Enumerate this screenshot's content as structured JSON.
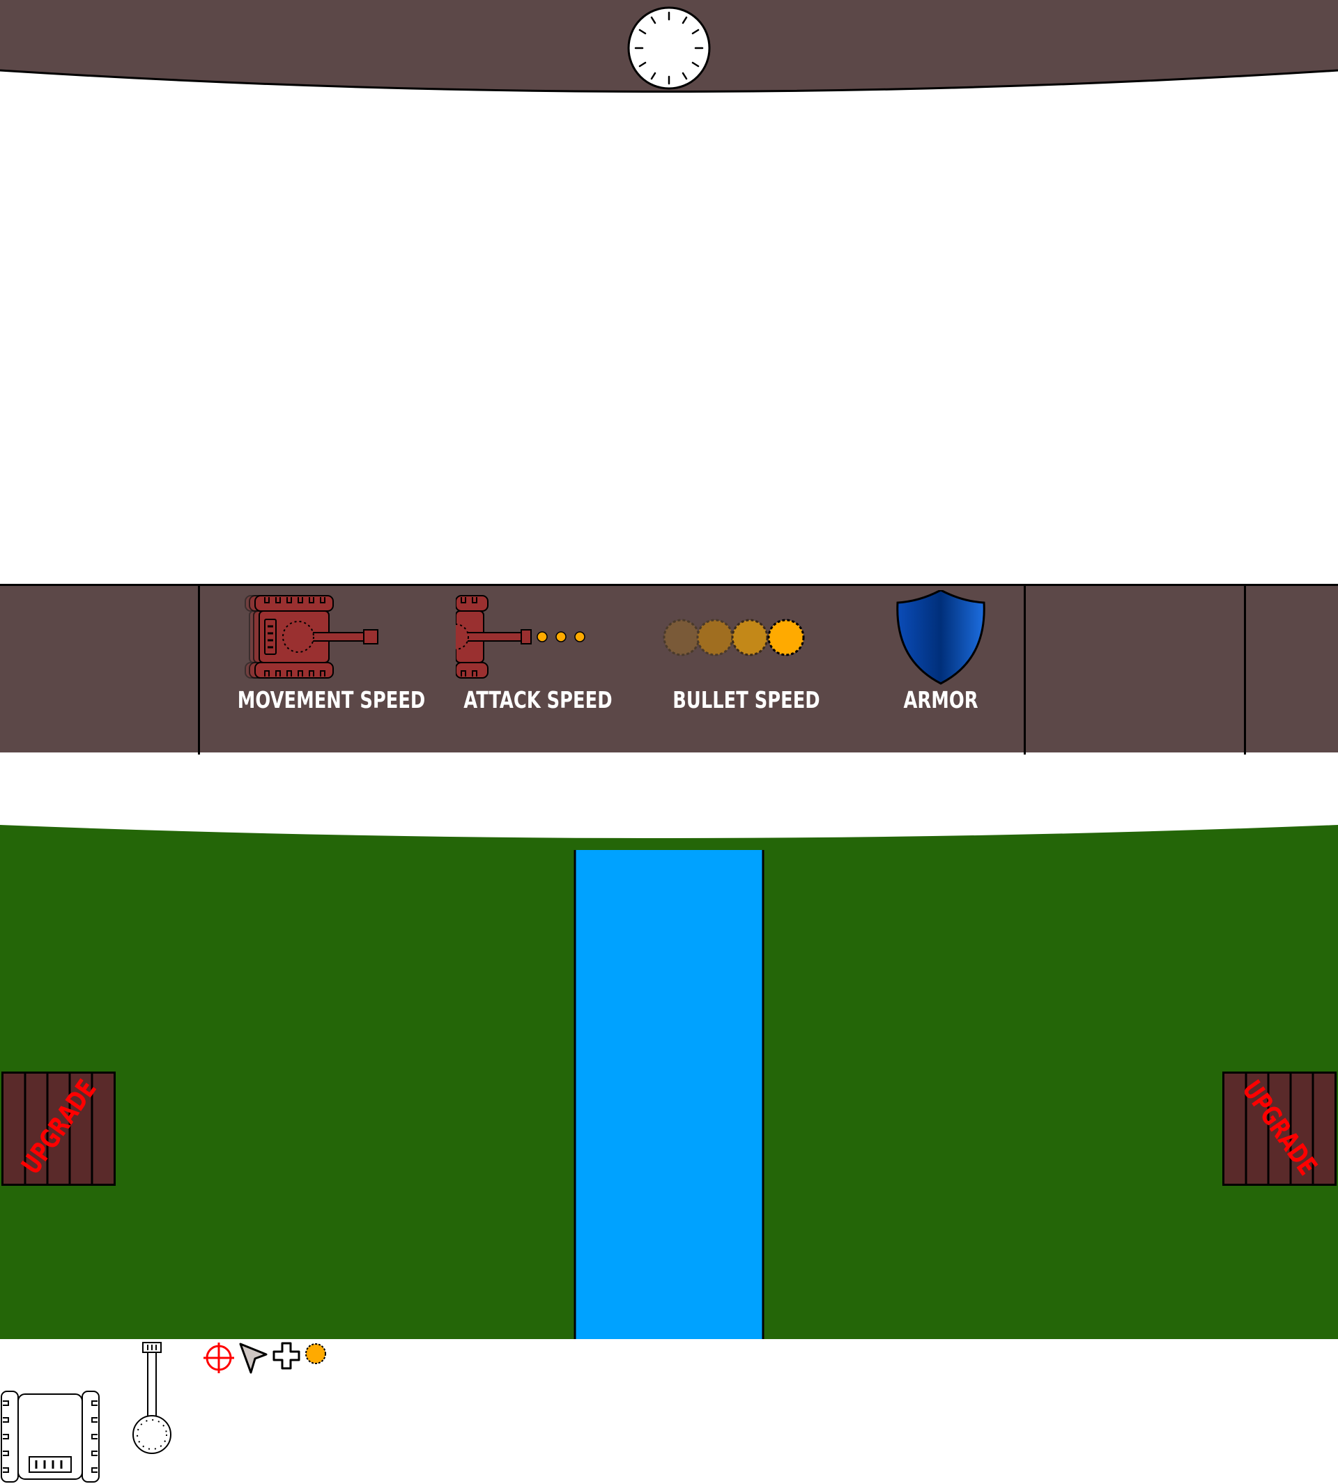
{
  "hud": {
    "timer_icon": "clock-icon"
  },
  "upgrades": {
    "items": [
      {
        "id": "movement",
        "label": "MOVEMENT SPEED",
        "icon": "tank-speed-icon"
      },
      {
        "id": "attack",
        "label": "ATTACK SPEED",
        "icon": "tank-firing-icon"
      },
      {
        "id": "bullet",
        "label": "BULLET SPEED",
        "icon": "bullet-trail-icon"
      },
      {
        "id": "armor",
        "label": "ARMOR",
        "icon": "shield-icon"
      }
    ]
  },
  "battlefield": {
    "crate_left_label": "UPGRADE",
    "crate_right_label": "UPGRADE"
  },
  "sprites": {
    "tank_body": "tank-body-icon",
    "tank_turret": "tank-turret-icon",
    "crosshair": "crosshair-icon",
    "cursor": "cursor-arrow-icon",
    "plus": "plus-icon",
    "coin": "coin-icon"
  },
  "colors": {
    "panel": "#5c4848",
    "grass": "#246608",
    "river": "#00a2ff",
    "crate": "#5a2a2a",
    "crate_text": "#ff0000",
    "tank": "#9a3030",
    "bullet": "#ffaa00",
    "shield": "#0b4cb8"
  }
}
